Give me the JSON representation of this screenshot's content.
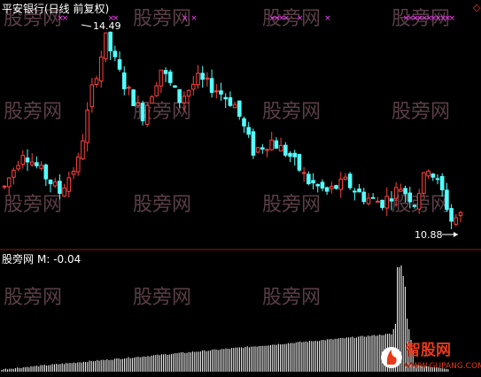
{
  "chart_data": [
    {
      "type": "candlestick",
      "title": "平安银行(日线 前复权)",
      "annotations": {
        "high_label": "14.49",
        "low_label": "10.88"
      },
      "marker_symbol": "×",
      "ylim": [
        10.5,
        14.9
      ],
      "colors": {
        "up": "#ff4040",
        "down": "#54ffff",
        "marker": "#ff40ff",
        "text": "#ffffff"
      }
    },
    {
      "type": "bar",
      "title": "股旁网",
      "value_label": "M: -0.04",
      "colors": {
        "bar": "#ffffff"
      }
    }
  ],
  "watermark": {
    "text": "股旁网",
    "color": "#5a3e46"
  },
  "logo": {
    "text": "智股网",
    "sub": "WWW.GUPANG.COM"
  }
}
